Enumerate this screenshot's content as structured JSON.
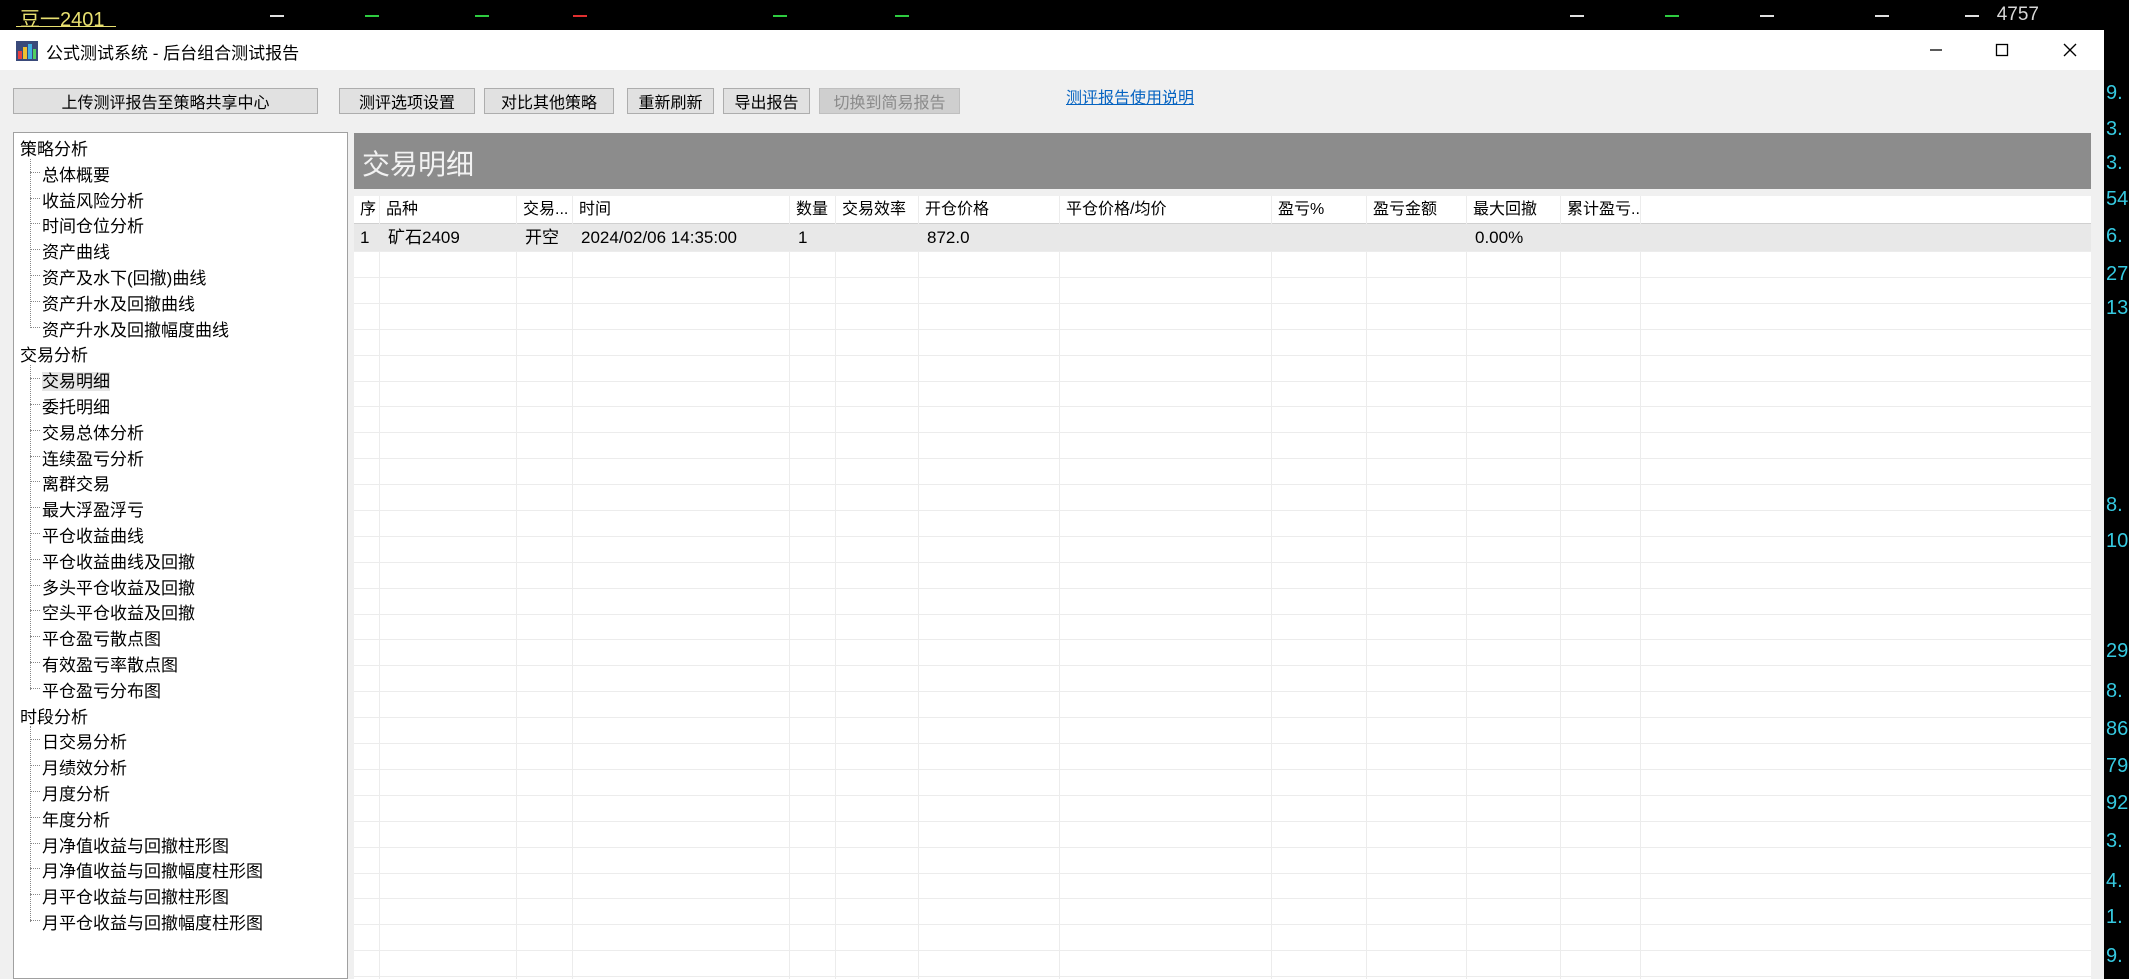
{
  "background": {
    "symbol": "豆一2401",
    "price": "4757",
    "right_edge_numbers": [
      "9.",
      "3.",
      "3.",
      "54",
      "6.",
      "27",
      "13",
      "8.",
      "10",
      "29",
      "8.",
      "86",
      "79",
      "92",
      "3.",
      "4.",
      "1.",
      "9."
    ]
  },
  "window": {
    "title": "公式测试系统 - 后台组合测试报告",
    "controls": {
      "minimize": "—",
      "maximize": "☐",
      "close": "✕"
    }
  },
  "toolbar": {
    "upload": "上传测评报告至策略共享中心",
    "options": "测评选项设置",
    "compare": "对比其他策略",
    "refresh": "重新刷新",
    "export": "导出报告",
    "switch_simple": "切换到简易报告",
    "help_link": "测评报告使用说明"
  },
  "tree": {
    "categories": [
      {
        "label": "策略分析",
        "items": [
          "总体概要",
          "收益风险分析",
          "时间仓位分析",
          "资产曲线",
          "资产及水下(回撤)曲线",
          "资产升水及回撤曲线",
          "资产升水及回撤幅度曲线"
        ]
      },
      {
        "label": "交易分析",
        "items": [
          "交易明细",
          "委托明细",
          "交易总体分析",
          "连续盈亏分析",
          "离群交易",
          "最大浮盈浮亏",
          "平仓收益曲线",
          "平仓收益曲线及回撤",
          "多头平仓收益及回撤",
          "空头平仓收益及回撤",
          "平仓盈亏散点图",
          "有效盈亏率散点图",
          "平仓盈亏分布图"
        ]
      },
      {
        "label": "时段分析",
        "items": [
          "日交易分析",
          "月绩效分析",
          "月度分析",
          "年度分析",
          "月净值收益与回撤柱形图",
          "月净值收益与回撤幅度柱形图",
          "月平仓收益与回撤柱形图",
          "月平仓收益与回撤幅度柱形图"
        ]
      }
    ],
    "selected": "交易明细"
  },
  "main": {
    "title": "交易明细",
    "columns": [
      "序",
      "品种",
      "交易...",
      "时间",
      "数量",
      "交易效率",
      "开仓价格",
      "平仓价格/均价",
      "盈亏%",
      "盈亏金额",
      "最大回撤",
      "累计盈亏..."
    ],
    "rows": [
      [
        "1",
        "矿石2409",
        "开空",
        "2024/02/06 14:35:00",
        "1",
        "",
        "872.0",
        "",
        "",
        "",
        "0.00%",
        ""
      ]
    ]
  },
  "colors": {
    "header_band": "#8c8c8c",
    "link": "#0563c1",
    "selected_row": "#e8e8e8"
  }
}
